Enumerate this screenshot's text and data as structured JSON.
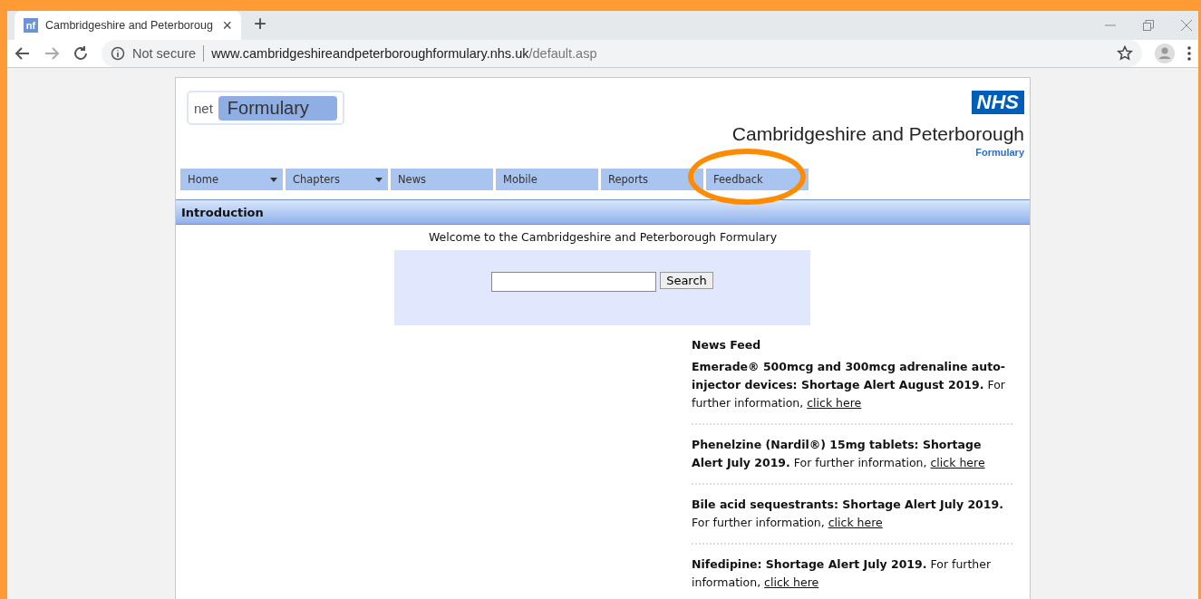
{
  "browser": {
    "tab": {
      "favicon": "nf",
      "title": "Cambridgeshire and Peterboroug",
      "close": "×",
      "selected": true
    },
    "new_tab": "+",
    "security": "Not secure",
    "url_host": "www.cambridgeshireandpeterboroughformulary.nhs.uk",
    "url_path": "/default.asp"
  },
  "header": {
    "logo_small": "net",
    "logo_main": "Formulary",
    "nhs": "NHS",
    "org": "Cambridgeshire and Peterborough",
    "sub": "Formulary"
  },
  "nav": [
    {
      "label": "Home",
      "dropdown": true,
      "highlighted": false
    },
    {
      "label": "Chapters",
      "dropdown": true,
      "highlighted": false
    },
    {
      "label": "News",
      "dropdown": false,
      "highlighted": false
    },
    {
      "label": "Mobile",
      "dropdown": false,
      "highlighted": false
    },
    {
      "label": "Reports",
      "dropdown": false,
      "highlighted": false
    },
    {
      "label": "Feedback",
      "dropdown": false,
      "highlighted": true
    }
  ],
  "section_title": "Introduction",
  "welcome": "Welcome to the Cambridgeshire and Peterborough Formulary",
  "search": {
    "button": "Search"
  },
  "news_feed": {
    "title": "News Feed",
    "items": [
      {
        "headline": "Emerade® 500mcg and 300mcg adrenaline auto-injector devices: Shortage Alert August 2019.",
        "text": "For further information,",
        "link": "click here"
      },
      {
        "headline": "Phenelzine (Nardil®) 15mg tablets: Shortage Alert July 2019.",
        "text": "For further information,",
        "link": "click here"
      },
      {
        "headline": "Bile acid sequestrants: Shortage Alert July 2019.",
        "text": "For further information,",
        "link": "click here"
      },
      {
        "headline": "Nifedipine: Shortage Alert July 2019.",
        "text": "For further information,",
        "link": "click here"
      }
    ]
  }
}
